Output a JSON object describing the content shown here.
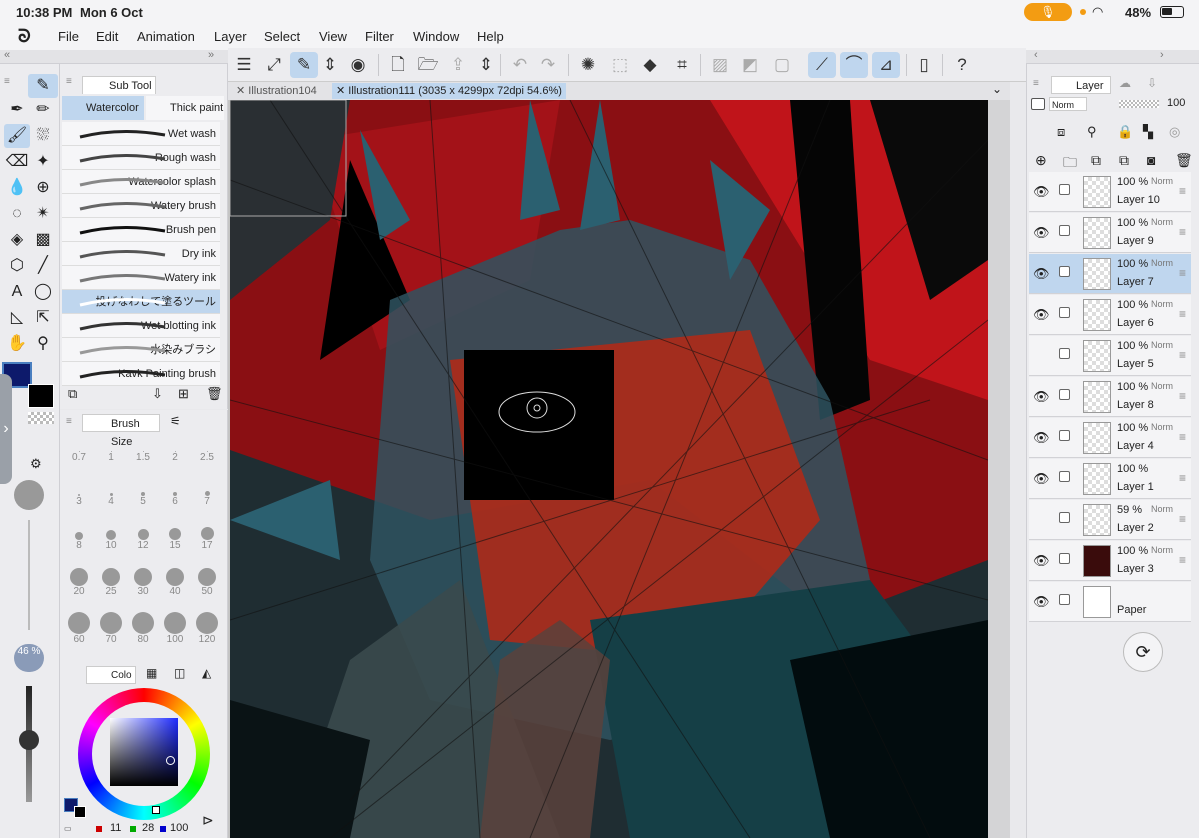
{
  "status": {
    "time": "10:38 PM",
    "date": "Mon 6 Oct",
    "battery": "48%"
  },
  "menu": [
    "File",
    "Edit",
    "Animation",
    "Layer",
    "Select",
    "View",
    "Filter",
    "Window",
    "Help"
  ],
  "tabs": [
    "Illustration104",
    "Illustration111 (3035 x 4299px 72dpi 54.6%)"
  ],
  "subtool": {
    "title": "Sub Tool",
    "groups": [
      "Watercolor",
      "Thick paint"
    ],
    "brushes": [
      "Wet wash",
      "Rough wash",
      "Watercolor splash",
      "Watery brush",
      "Brush pen",
      "Dry ink",
      "Watery ink",
      "投げなわして塗るツール",
      "Wet blotting ink",
      "水染みブラシ",
      "Kavk Painting brush"
    ]
  },
  "brushsize": {
    "title": "Brush Size",
    "sizes": [
      "0.7",
      "1",
      "1.5",
      "2",
      "2.5",
      "3",
      "4",
      "5",
      "6",
      "7",
      "8",
      "10",
      "12",
      "15",
      "17",
      "20",
      "25",
      "30",
      "40",
      "50",
      "60",
      "70",
      "80",
      "100",
      "120"
    ]
  },
  "tools_left": {
    "opacity": "46 %"
  },
  "color": {
    "tab": "Colo",
    "r": "11",
    "g": "28",
    "b": "100",
    "main_color": "#0d1a6b"
  },
  "layers": {
    "title": "Layer",
    "blend": "Norm",
    "opacity": "100",
    "items": [
      {
        "name": "Layer 10",
        "opacity": "100 %",
        "blend": "Norm",
        "visible": true
      },
      {
        "name": "Layer 9",
        "opacity": "100 %",
        "blend": "Norm",
        "visible": true
      },
      {
        "name": "Layer 7",
        "opacity": "100 %",
        "blend": "Norm",
        "visible": true
      },
      {
        "name": "Layer 6",
        "opacity": "100 %",
        "blend": "Norm",
        "visible": true
      },
      {
        "name": "Layer 5",
        "opacity": "100 %",
        "blend": "Norm",
        "visible": false
      },
      {
        "name": "Layer 8",
        "opacity": "100 %",
        "blend": "Norm",
        "visible": true
      },
      {
        "name": "Layer 4",
        "opacity": "100 %",
        "blend": "Norm",
        "visible": true
      },
      {
        "name": "Layer 1",
        "opacity": "100 %",
        "blend": "",
        "visible": true
      },
      {
        "name": "Layer 2",
        "opacity": "59 %",
        "blend": "Norm",
        "visible": false
      },
      {
        "name": "Layer 3",
        "opacity": "100 %",
        "blend": "Norm",
        "visible": true
      },
      {
        "name": "Paper",
        "opacity": "",
        "blend": "",
        "visible": true
      }
    ]
  }
}
